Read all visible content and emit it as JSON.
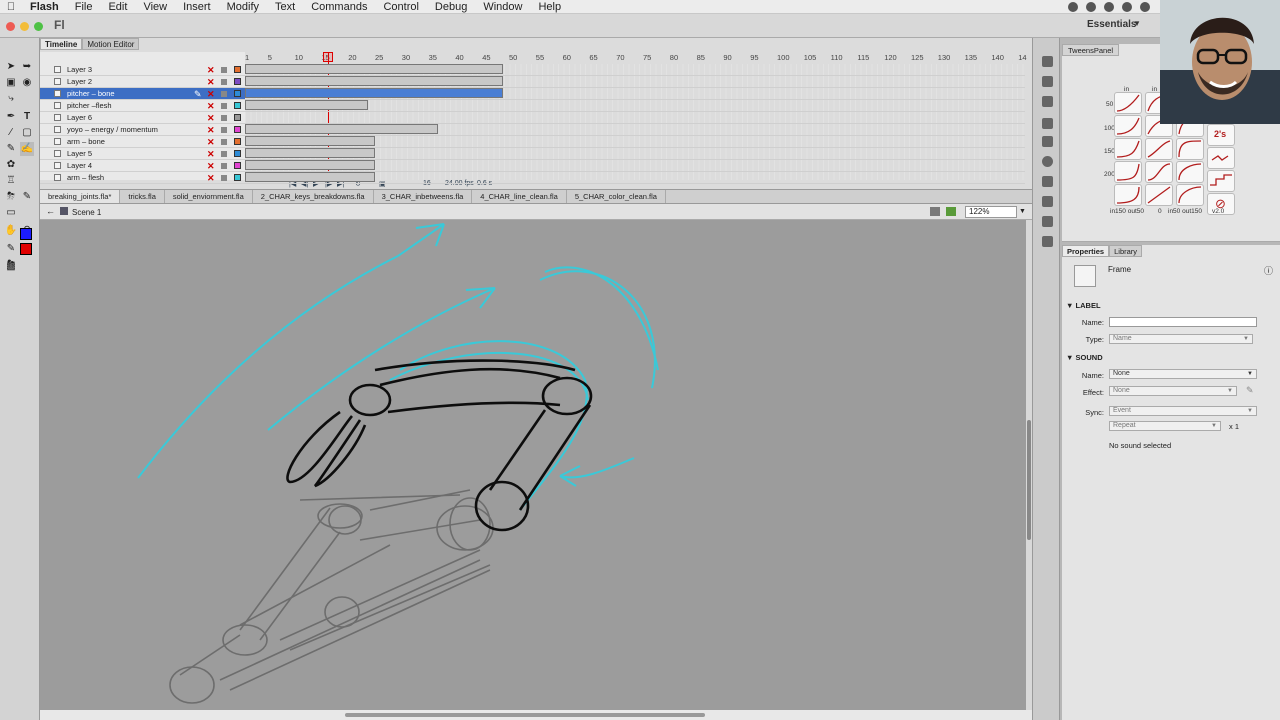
{
  "menubar": {
    "apple": "",
    "items": [
      "Flash",
      "File",
      "Edit",
      "View",
      "Insert",
      "Modify",
      "Text",
      "Commands",
      "Control",
      "Debug",
      "Window",
      "Help"
    ]
  },
  "app": {
    "logo": "Fl",
    "workspace": "Essentials"
  },
  "timeline": {
    "tabs": [
      "Timeline",
      "Motion Editor"
    ],
    "ruler": [
      "1",
      "5",
      "10",
      "15",
      "20",
      "25",
      "30",
      "35",
      "40",
      "45",
      "50",
      "55",
      "60",
      "65",
      "70",
      "75",
      "80",
      "85",
      "90",
      "95",
      "100",
      "105",
      "110",
      "115",
      "120",
      "125",
      "130",
      "135",
      "140",
      "14"
    ],
    "layers": [
      {
        "name": "Layer 3",
        "selected": false
      },
      {
        "name": "Layer 2",
        "selected": false
      },
      {
        "name": "pitcher – bone",
        "selected": true
      },
      {
        "name": "pitcher –flesh",
        "selected": false
      },
      {
        "name": "Layer 6",
        "selected": false
      },
      {
        "name": "yoyo – energy / momentum",
        "selected": false
      },
      {
        "name": "arm – bone",
        "selected": false
      },
      {
        "name": "Layer 5",
        "selected": false
      },
      {
        "name": "Layer 4",
        "selected": false
      },
      {
        "name": "arm – flesh",
        "selected": false
      }
    ],
    "footer": {
      "frame": "16",
      "fps": "24.00 fps",
      "time": "0.6 s"
    },
    "current_frame": 16
  },
  "doc_tabs": [
    "breaking_joints.fla*",
    "tricks.fla",
    "solid_enviornment.fla",
    "2_CHAR_keys_breakdowns.fla",
    "3_CHAR_inbetweens.fla",
    "4_CHAR_line_clean.fla",
    "5_CHAR_color_clean.fla"
  ],
  "scene": {
    "label": "Scene 1",
    "zoom": "122%"
  },
  "tweens_panel": {
    "title": "TweensPanel",
    "col_labels": [
      "in",
      "in"
    ],
    "row_labels": [
      "50",
      "100",
      "150",
      "200"
    ],
    "bottom_labels": [
      "in150 out50",
      "0",
      "in50 out150",
      "v2.0"
    ],
    "badge": "2's"
  },
  "properties": {
    "tabs": [
      "Properties",
      "Library"
    ],
    "type": "Frame",
    "label_section": "LABEL",
    "name_label": "Name:",
    "name_value": "",
    "type_label": "Type:",
    "type_value": "Name",
    "sound_section": "SOUND",
    "sound_name_label": "Name:",
    "sound_name_value": "None",
    "effect_label": "Effect:",
    "effect_value": "None",
    "sync_label": "Sync:",
    "sync_value": "Event",
    "repeat_value": "Repeat",
    "repeat_count": "x 1",
    "no_sound": "No sound selected"
  },
  "colors": {
    "accent_blue": "#3d6ec4",
    "stroke_color": "#1c1cff",
    "fill_color": "#e00000",
    "sketch_cyan": "#39c7d6"
  }
}
